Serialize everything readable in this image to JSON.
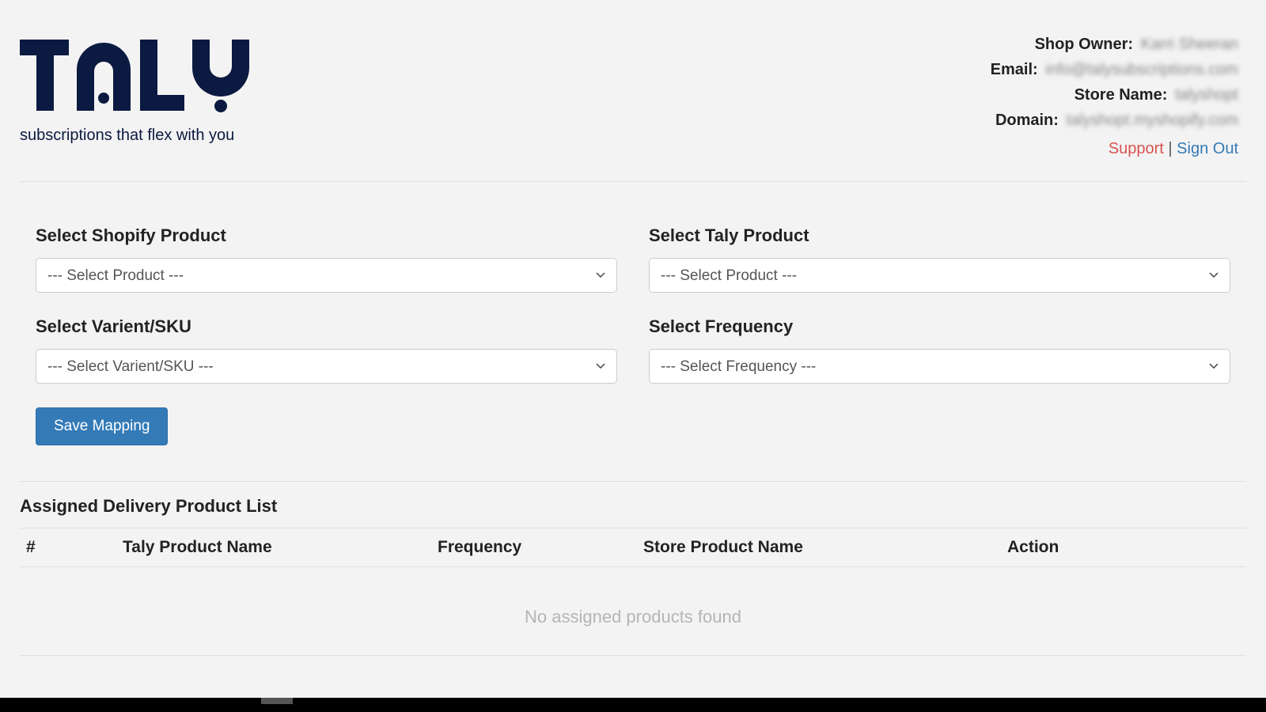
{
  "brand": {
    "name": "TALY",
    "tagline": "subscriptions that flex with you"
  },
  "shop_info": {
    "owner_label": "Shop Owner:",
    "owner_value": "Karri Sheeran",
    "email_label": "Email:",
    "email_value": "info@talysubscriptions.com",
    "store_label": "Store Name:",
    "store_value": "talyshopt",
    "domain_label": "Domain:",
    "domain_value": "talyshopt.myshopify.com"
  },
  "links": {
    "support": "Support",
    "signout": "Sign Out"
  },
  "form": {
    "shopify_product": {
      "label": "Select Shopify Product",
      "placeholder": "--- Select Product ---"
    },
    "taly_product": {
      "label": "Select Taly Product",
      "placeholder": "--- Select Product ---"
    },
    "variant": {
      "label": "Select Varient/SKU",
      "placeholder": "--- Select Varient/SKU ---"
    },
    "frequency": {
      "label": "Select Frequency",
      "placeholder": "--- Select Frequency ---"
    },
    "save_label": "Save Mapping"
  },
  "list": {
    "title": "Assigned Delivery Product List",
    "columns": {
      "num": "#",
      "taly_name": "Taly Product Name",
      "frequency": "Frequency",
      "store_name": "Store Product Name",
      "action": "Action"
    },
    "empty": "No assigned products found"
  }
}
